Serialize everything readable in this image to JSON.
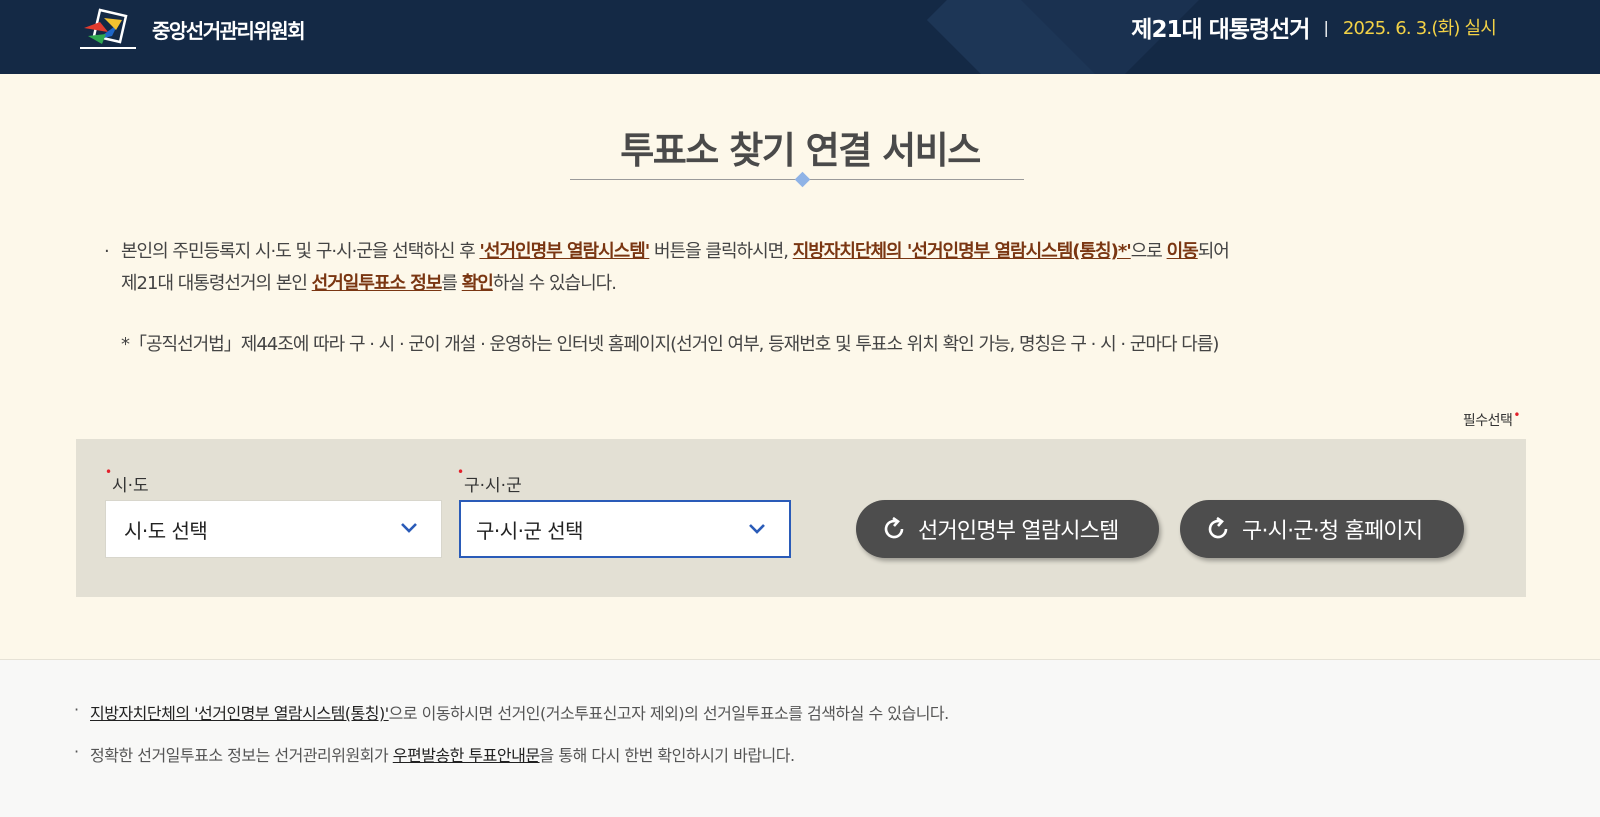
{
  "header": {
    "org_name": "중앙선거관리위원회",
    "election_name": "제21대 대통령선거",
    "separator": "|",
    "election_date": "2025. 6. 3.(화) 실시"
  },
  "main": {
    "title": "투표소 찾기 연결 서비스",
    "bullet": "·",
    "desc": {
      "p1": "본인의 주민등록지 시·도 및 구·시·군을 선택하신 후 ",
      "hl1": "'선거인명부 열람시스템'",
      "p2": " 버튼을 클릭하시면, ",
      "hl2": "지방자치단체의 '선거인명부 열람시스템(통칭)*'",
      "p3": "으로 ",
      "hl3": "이동",
      "p4": "되어",
      "p5": "제21대 대통령선거의 본인 ",
      "hl4": "선거일투표소 정보",
      "p6": "를 ",
      "hl5": "확인",
      "p7": "하실 수 있습니다.",
      "note": "*「공직선거법」제44조에 따라 구 · 시 · 군이 개설 · 운영하는 인터넷 홈페이지(선거인 여부, 등재번호 및 투표소 위치 확인 가능, 명칭은 구 · 시 · 군마다 다름)"
    },
    "required_label": "필수선택",
    "required_mark": "•",
    "form": {
      "sido_label": "시·도",
      "sido_value": "시·도 선택",
      "gusigun_label": "구·시·군",
      "gusigun_value": "구·시·군 선택",
      "btn_registry": "선거인명부 열람시스템",
      "btn_homepage": "구·시·군·청 홈페이지"
    }
  },
  "footer": {
    "bullet": "·",
    "n1_link": "지방자치단체의 '선거인명부 열람시스템(통칭)'",
    "n1_rest": "으로 이동하시면 선거인(거소투표신고자 제외)의 선거일투표소를 검색하실 수 있습니다.",
    "n2_pre": "정확한 선거일투표소 정보는 선거관리위원회가 ",
    "n2_link": "우편발송한 투표안내문",
    "n2_rest": "을 통해 다시 한번 확인하시기 바랍니다."
  },
  "colors": {
    "header_bg": "#142945",
    "date_yellow": "#f3d246",
    "highlight_brown": "#7a3612",
    "required_red": "#e3212b",
    "active_border": "#2a5bb8",
    "button_bg": "#4d4d4d"
  },
  "icons": [
    "nec-logo-icon",
    "chevron-down-icon",
    "refresh-icon"
  ]
}
